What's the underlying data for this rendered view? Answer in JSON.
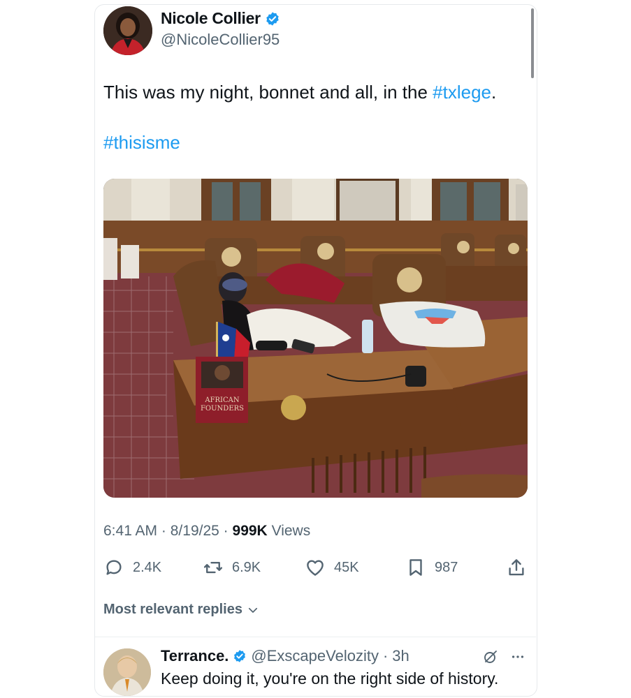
{
  "tweet": {
    "author_name": "Nicole Collier",
    "author_handle": "@NicoleCollier95",
    "text_before": "This was my night, bonnet and all, in the ",
    "hashtag1": "#txlege",
    "text_after": ".",
    "hashtag2": "#thisisme",
    "time": "6:41 AM",
    "date": "8/19/25",
    "views_count": "999K",
    "views_label": "Views",
    "sep": "·"
  },
  "photo": {
    "book_line1": "AFRICAN",
    "book_line2": "FOUNDERS"
  },
  "actions": {
    "replies": "2.4K",
    "reposts": "6.9K",
    "likes": "45K",
    "bookmarks": "987"
  },
  "replies_section": {
    "label": "Most relevant replies"
  },
  "reply": {
    "name": "Terrance.",
    "handle": "@ExscapeVelozity",
    "sep": "·",
    "time": "3h",
    "text": "Keep doing it, you're on the right side of history."
  },
  "colors": {
    "accent": "#1d9bf0",
    "muted": "#536471",
    "verified": "#1d9bf0"
  }
}
